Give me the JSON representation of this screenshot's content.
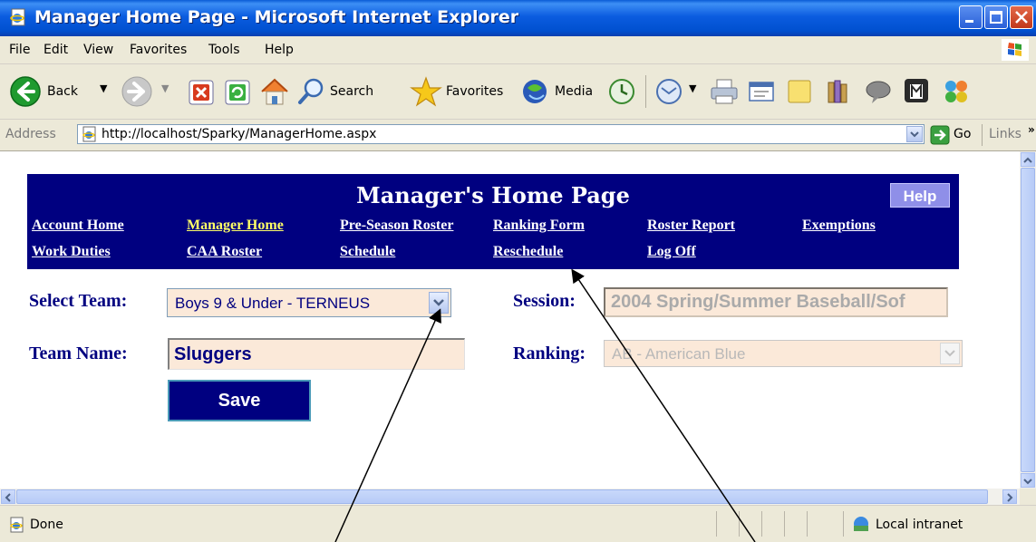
{
  "window": {
    "title": "Manager Home Page - Microsoft Internet Explorer"
  },
  "menu": [
    "File",
    "Edit",
    "View",
    "Favorites",
    "Tools",
    "Help"
  ],
  "toolbar": {
    "back": "Back",
    "search": "Search",
    "favorites": "Favorites",
    "media": "Media"
  },
  "address": {
    "label": "Address",
    "url": "http://localhost/Sparky/ManagerHome.aspx",
    "go": "Go",
    "links": "Links"
  },
  "page": {
    "title": "Manager's Home Page",
    "help": "Help",
    "nav": [
      "Account Home",
      "Manager Home",
      "Pre-Season Roster",
      "Ranking Form",
      "Roster Report",
      "Exemptions",
      "Work Duties",
      "CAA Roster",
      "Schedule",
      "Reschedule",
      "Log Off"
    ],
    "active_nav": "Manager Home",
    "form": {
      "select_team_label": "Select Team:",
      "select_team_value": "Boys 9 & Under - TERNEUS",
      "team_name_label": "Team Name:",
      "team_name_value": "Sluggers",
      "session_label": "Session:",
      "session_value": "2004 Spring/Summer Baseball/Sof",
      "ranking_label": "Ranking:",
      "ranking_value": "AB - American Blue",
      "save": "Save"
    }
  },
  "status": {
    "text": "Done",
    "zone": "Local intranet"
  },
  "colors": {
    "banner": "#000080",
    "active_link": "#ffff66",
    "field_bg": "#fbe9d9",
    "help_bg": "#8f8fe8"
  }
}
